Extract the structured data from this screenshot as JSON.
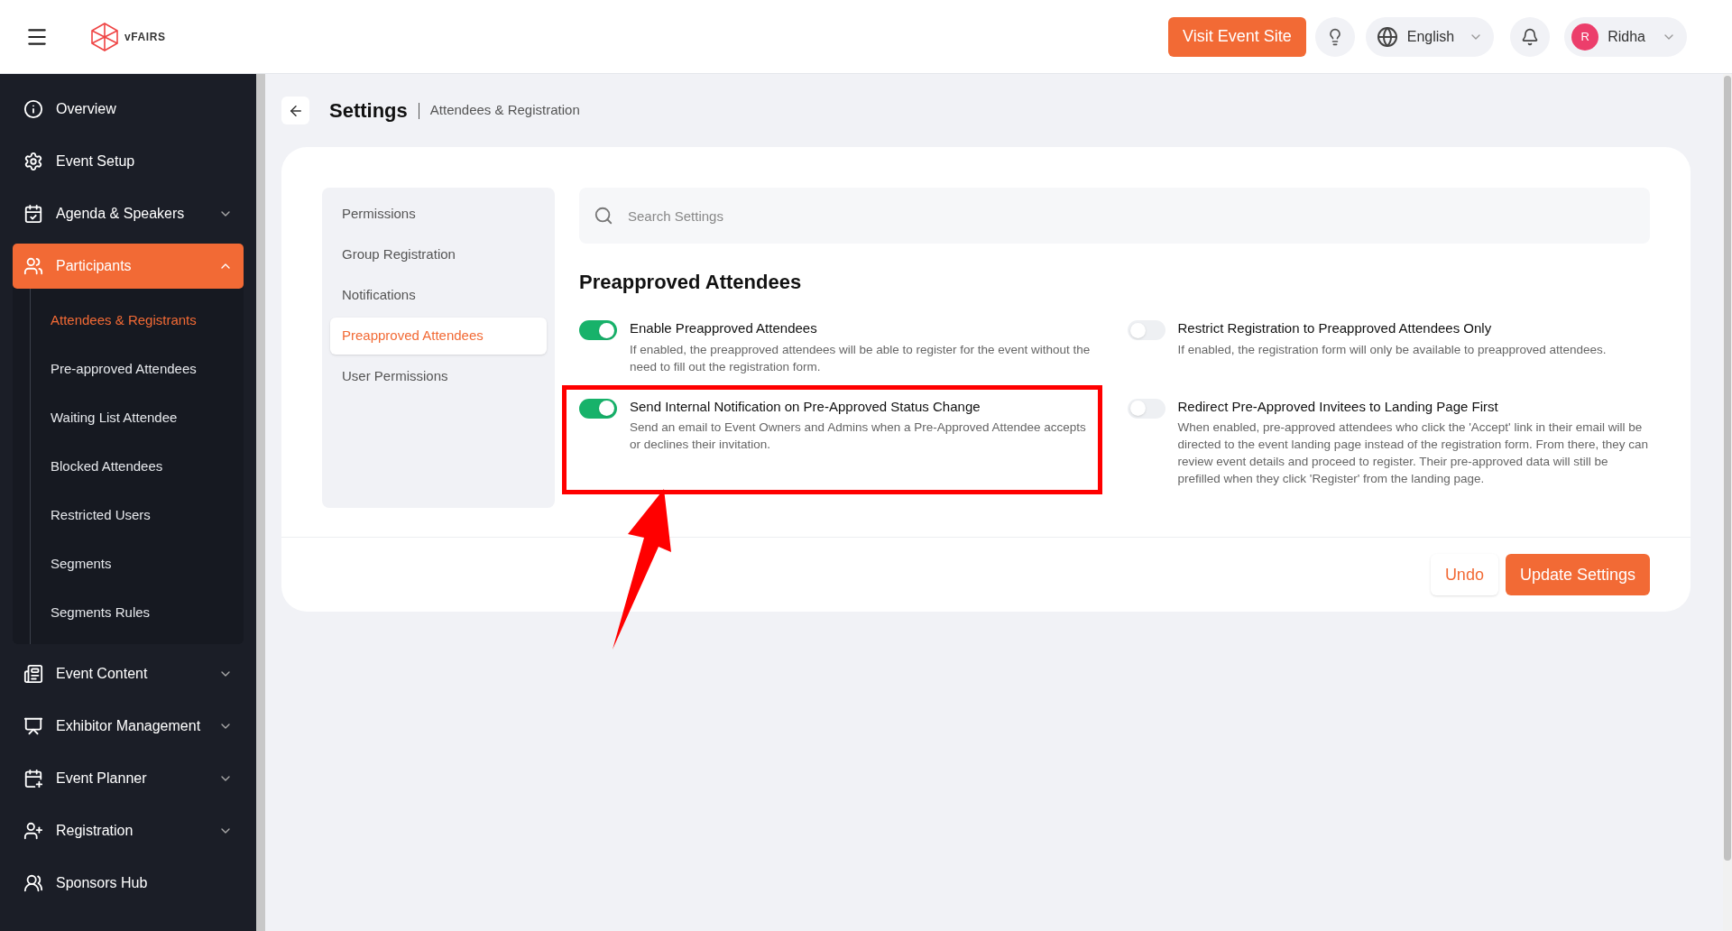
{
  "header": {
    "logo_text": "vFAIRS",
    "visit_button": "Visit Event Site",
    "language": "English",
    "user": {
      "initial": "R",
      "name": "Ridha"
    }
  },
  "sidebar": {
    "items": [
      {
        "label": "Overview",
        "kind": "link",
        "selected": false
      },
      {
        "label": "Event Setup",
        "kind": "link",
        "selected": false
      },
      {
        "label": "Agenda & Speakers",
        "kind": "group",
        "expanded": false,
        "selected": false
      },
      {
        "label": "Participants",
        "kind": "group",
        "expanded": true,
        "selected": true,
        "children": [
          {
            "label": "Attendees & Registrants",
            "selected": true
          },
          {
            "label": "Pre-approved Attendees",
            "selected": false
          },
          {
            "label": "Waiting List Attendee",
            "selected": false
          },
          {
            "label": "Blocked Attendees",
            "selected": false
          },
          {
            "label": "Restricted Users",
            "selected": false
          },
          {
            "label": "Segments",
            "selected": false
          },
          {
            "label": "Segments Rules",
            "selected": false
          }
        ]
      },
      {
        "label": "Event Content",
        "kind": "group",
        "expanded": false,
        "selected": false
      },
      {
        "label": "Exhibitor Management",
        "kind": "group",
        "expanded": false,
        "selected": false
      },
      {
        "label": "Event Planner",
        "kind": "group",
        "expanded": false,
        "selected": false
      },
      {
        "label": "Registration",
        "kind": "group",
        "expanded": false,
        "selected": false
      },
      {
        "label": "Sponsors Hub",
        "kind": "link",
        "selected": false
      }
    ]
  },
  "page": {
    "title": "Settings",
    "breadcrumb": "Attendees & Registration"
  },
  "settings_nav": [
    {
      "label": "Permissions",
      "selected": false
    },
    {
      "label": "Group Registration",
      "selected": false
    },
    {
      "label": "Notifications",
      "selected": false
    },
    {
      "label": "Preapproved Attendees",
      "selected": true
    },
    {
      "label": "User Permissions",
      "selected": false
    }
  ],
  "search": {
    "placeholder": "Search Settings"
  },
  "section_title": "Preapproved Attendees",
  "options": [
    {
      "title": "Enable Preapproved Attendees",
      "description": "If enabled, the preapproved attendees will be able to register for the event without the need to fill out the registration form.",
      "on": true,
      "highlighted": false
    },
    {
      "title": "Restrict Registration to Preapproved Attendees Only",
      "description": "If enabled, the registration form will only be available to preapproved attendees.",
      "on": false,
      "highlighted": false
    },
    {
      "title": "Send Internal Notification on Pre-Approved Status Change",
      "description": "Send an email to Event Owners and Admins when a Pre-Approved Attendee accepts or declines their invitation.",
      "on": true,
      "highlighted": true
    },
    {
      "title": "Redirect Pre-Approved Invitees to Landing Page First",
      "description": "When enabled, pre-approved attendees who click the 'Accept' link in their email will be directed to the event landing page instead of the registration form. From there, they can review event details and proceed to register. Their pre-approved data will still be prefilled when they click 'Register' from the landing page.",
      "on": false,
      "highlighted": false
    }
  ],
  "footer": {
    "undo": "Undo",
    "update": "Update Settings"
  }
}
